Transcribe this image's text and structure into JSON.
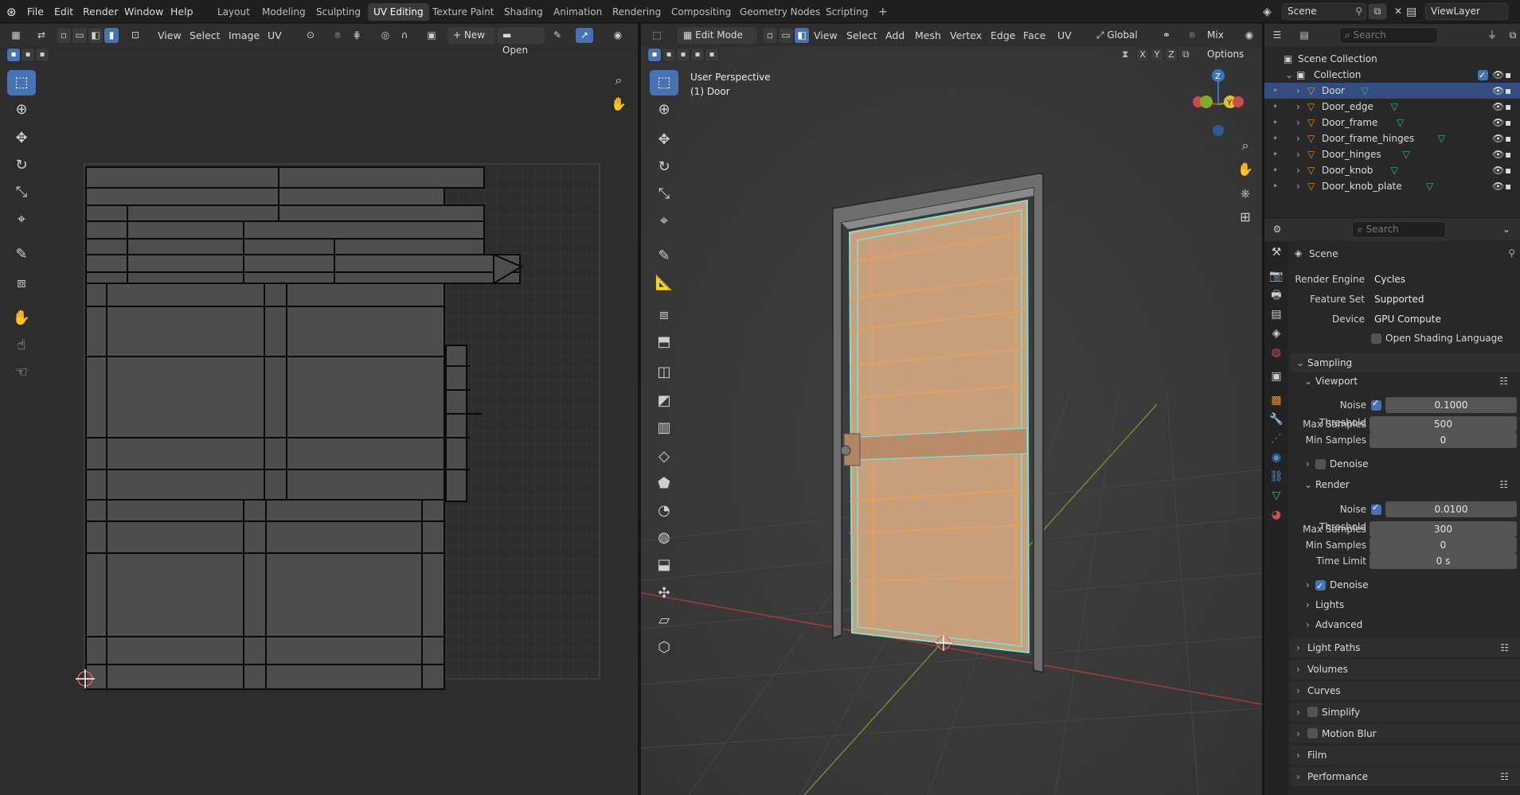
{
  "topbar": {
    "menus": [
      "File",
      "Edit",
      "Render",
      "Window",
      "Help"
    ],
    "workspaces": [
      "Layout",
      "Modeling",
      "Sculpting",
      "UV Editing",
      "Texture Paint",
      "Shading",
      "Animation",
      "Rendering",
      "Compositing",
      "Geometry Nodes",
      "Scripting"
    ],
    "active_workspace": "UV Editing",
    "scene": "Scene",
    "view_layer": "ViewLayer"
  },
  "uv_editor": {
    "menus": [
      "View",
      "Select",
      "Image",
      "UV"
    ],
    "new_label": "New",
    "open_label": "Open"
  },
  "viewport": {
    "mode": "Edit Mode",
    "menus": [
      "View",
      "Select",
      "Add",
      "Mesh",
      "Vertex",
      "Edge",
      "Face",
      "UV"
    ],
    "orientation": "Global",
    "shading_mix": "Mix",
    "options_label": "Options",
    "overlay_title": "User Perspective",
    "overlay_object": "(1) Door",
    "axes": [
      "X",
      "Y",
      "Z"
    ]
  },
  "outliner": {
    "search_placeholder": "Search",
    "scene_collection": "Scene Collection",
    "collection": "Collection",
    "objects": [
      "Door",
      "Door_edge",
      "Door_frame",
      "Door_frame_hinges",
      "Door_hinges",
      "Door_knob",
      "Door_knob_plate"
    ],
    "selected": "Door"
  },
  "properties": {
    "search_placeholder": "Search",
    "context": "Scene",
    "render_engine_label": "Render Engine",
    "render_engine": "Cycles",
    "feature_set_label": "Feature Set",
    "feature_set": "Supported",
    "device_label": "Device",
    "device": "GPU Compute",
    "osl_label": "Open Shading Language",
    "sampling": "Sampling",
    "viewport": {
      "title": "Viewport",
      "noise_threshold_label": "Noise Threshold",
      "noise_threshold": "0.1000",
      "max_samples_label": "Max Samples",
      "max_samples": "500",
      "min_samples_label": "Min Samples",
      "min_samples": "0",
      "denoise_label": "Denoise"
    },
    "render": {
      "title": "Render",
      "noise_threshold_label": "Noise Threshold",
      "noise_threshold": "0.0100",
      "max_samples_label": "Max Samples",
      "max_samples": "300",
      "min_samples_label": "Min Samples",
      "min_samples": "0",
      "time_limit_label": "Time Limit",
      "time_limit": "0 s",
      "denoise_label": "Denoise"
    },
    "lights": "Lights",
    "advanced": "Advanced",
    "panels": [
      "Light Paths",
      "Volumes",
      "Curves",
      "Simplify",
      "Motion Blur",
      "Film",
      "Performance"
    ]
  },
  "colors": {
    "accent": "#4772b3",
    "door_face": "#c9a27e",
    "edge_orange": "#f0a050",
    "edge_cyan": "#7fe0d6"
  }
}
